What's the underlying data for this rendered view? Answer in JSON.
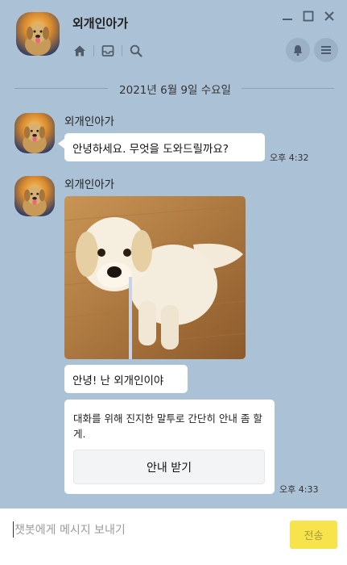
{
  "header": {
    "bot_name": "외개인아가",
    "icons": [
      "home-icon",
      "inbox-icon",
      "search-icon",
      "bell-icon",
      "menu-icon"
    ],
    "window_controls": [
      "minimize-icon",
      "maximize-icon",
      "close-icon"
    ]
  },
  "date_divider": "2021년 6월 9일 수요일",
  "messages": [
    {
      "sender": "외개인아가",
      "text": "안녕하세요. 무엇을 도와드릴까요?",
      "time": "오후 4:32"
    },
    {
      "sender": "외개인아가",
      "image": "golden-retriever-puppy-photo",
      "text": "안녕! 난 외개인이야",
      "card_text": "대화를 위해 진지한 말투로 간단히 안내 좀 할게.",
      "card_button": "안내 받기",
      "time": "오후 4:33"
    }
  ],
  "composer": {
    "placeholder": "챗봇에게 메시지 보내기",
    "send_label": "전송"
  },
  "colors": {
    "background": "#abc1d5",
    "send_button": "#f7e44c"
  }
}
